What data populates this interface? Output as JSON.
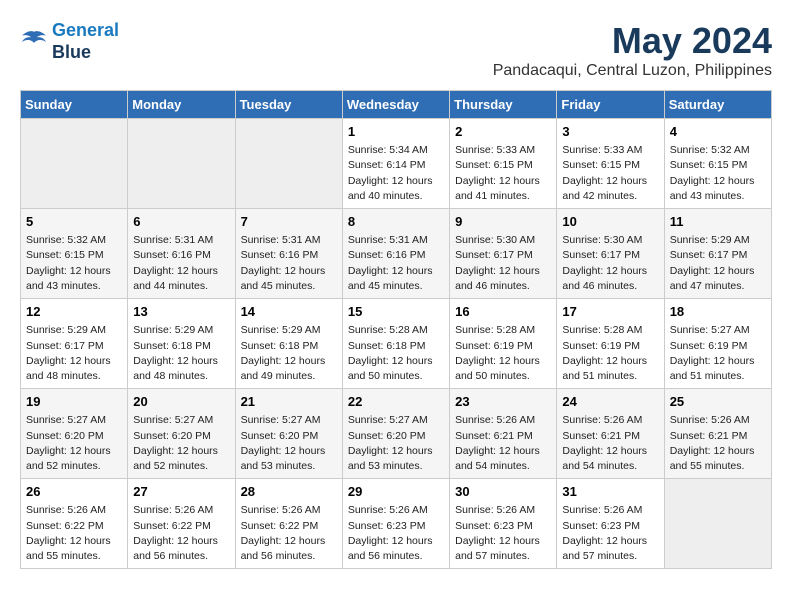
{
  "header": {
    "logo_line1": "General",
    "logo_line2": "Blue",
    "month": "May 2024",
    "location": "Pandacaqui, Central Luzon, Philippines"
  },
  "days_of_week": [
    "Sunday",
    "Monday",
    "Tuesday",
    "Wednesday",
    "Thursday",
    "Friday",
    "Saturday"
  ],
  "weeks": [
    [
      {
        "day": "",
        "info": ""
      },
      {
        "day": "",
        "info": ""
      },
      {
        "day": "",
        "info": ""
      },
      {
        "day": "1",
        "info": "Sunrise: 5:34 AM\nSunset: 6:14 PM\nDaylight: 12 hours\nand 40 minutes."
      },
      {
        "day": "2",
        "info": "Sunrise: 5:33 AM\nSunset: 6:15 PM\nDaylight: 12 hours\nand 41 minutes."
      },
      {
        "day": "3",
        "info": "Sunrise: 5:33 AM\nSunset: 6:15 PM\nDaylight: 12 hours\nand 42 minutes."
      },
      {
        "day": "4",
        "info": "Sunrise: 5:32 AM\nSunset: 6:15 PM\nDaylight: 12 hours\nand 43 minutes."
      }
    ],
    [
      {
        "day": "5",
        "info": "Sunrise: 5:32 AM\nSunset: 6:15 PM\nDaylight: 12 hours\nand 43 minutes."
      },
      {
        "day": "6",
        "info": "Sunrise: 5:31 AM\nSunset: 6:16 PM\nDaylight: 12 hours\nand 44 minutes."
      },
      {
        "day": "7",
        "info": "Sunrise: 5:31 AM\nSunset: 6:16 PM\nDaylight: 12 hours\nand 45 minutes."
      },
      {
        "day": "8",
        "info": "Sunrise: 5:31 AM\nSunset: 6:16 PM\nDaylight: 12 hours\nand 45 minutes."
      },
      {
        "day": "9",
        "info": "Sunrise: 5:30 AM\nSunset: 6:17 PM\nDaylight: 12 hours\nand 46 minutes."
      },
      {
        "day": "10",
        "info": "Sunrise: 5:30 AM\nSunset: 6:17 PM\nDaylight: 12 hours\nand 46 minutes."
      },
      {
        "day": "11",
        "info": "Sunrise: 5:29 AM\nSunset: 6:17 PM\nDaylight: 12 hours\nand 47 minutes."
      }
    ],
    [
      {
        "day": "12",
        "info": "Sunrise: 5:29 AM\nSunset: 6:17 PM\nDaylight: 12 hours\nand 48 minutes."
      },
      {
        "day": "13",
        "info": "Sunrise: 5:29 AM\nSunset: 6:18 PM\nDaylight: 12 hours\nand 48 minutes."
      },
      {
        "day": "14",
        "info": "Sunrise: 5:29 AM\nSunset: 6:18 PM\nDaylight: 12 hours\nand 49 minutes."
      },
      {
        "day": "15",
        "info": "Sunrise: 5:28 AM\nSunset: 6:18 PM\nDaylight: 12 hours\nand 50 minutes."
      },
      {
        "day": "16",
        "info": "Sunrise: 5:28 AM\nSunset: 6:19 PM\nDaylight: 12 hours\nand 50 minutes."
      },
      {
        "day": "17",
        "info": "Sunrise: 5:28 AM\nSunset: 6:19 PM\nDaylight: 12 hours\nand 51 minutes."
      },
      {
        "day": "18",
        "info": "Sunrise: 5:27 AM\nSunset: 6:19 PM\nDaylight: 12 hours\nand 51 minutes."
      }
    ],
    [
      {
        "day": "19",
        "info": "Sunrise: 5:27 AM\nSunset: 6:20 PM\nDaylight: 12 hours\nand 52 minutes."
      },
      {
        "day": "20",
        "info": "Sunrise: 5:27 AM\nSunset: 6:20 PM\nDaylight: 12 hours\nand 52 minutes."
      },
      {
        "day": "21",
        "info": "Sunrise: 5:27 AM\nSunset: 6:20 PM\nDaylight: 12 hours\nand 53 minutes."
      },
      {
        "day": "22",
        "info": "Sunrise: 5:27 AM\nSunset: 6:20 PM\nDaylight: 12 hours\nand 53 minutes."
      },
      {
        "day": "23",
        "info": "Sunrise: 5:26 AM\nSunset: 6:21 PM\nDaylight: 12 hours\nand 54 minutes."
      },
      {
        "day": "24",
        "info": "Sunrise: 5:26 AM\nSunset: 6:21 PM\nDaylight: 12 hours\nand 54 minutes."
      },
      {
        "day": "25",
        "info": "Sunrise: 5:26 AM\nSunset: 6:21 PM\nDaylight: 12 hours\nand 55 minutes."
      }
    ],
    [
      {
        "day": "26",
        "info": "Sunrise: 5:26 AM\nSunset: 6:22 PM\nDaylight: 12 hours\nand 55 minutes."
      },
      {
        "day": "27",
        "info": "Sunrise: 5:26 AM\nSunset: 6:22 PM\nDaylight: 12 hours\nand 56 minutes."
      },
      {
        "day": "28",
        "info": "Sunrise: 5:26 AM\nSunset: 6:22 PM\nDaylight: 12 hours\nand 56 minutes."
      },
      {
        "day": "29",
        "info": "Sunrise: 5:26 AM\nSunset: 6:23 PM\nDaylight: 12 hours\nand 56 minutes."
      },
      {
        "day": "30",
        "info": "Sunrise: 5:26 AM\nSunset: 6:23 PM\nDaylight: 12 hours\nand 57 minutes."
      },
      {
        "day": "31",
        "info": "Sunrise: 5:26 AM\nSunset: 6:23 PM\nDaylight: 12 hours\nand 57 minutes."
      },
      {
        "day": "",
        "info": ""
      }
    ]
  ]
}
